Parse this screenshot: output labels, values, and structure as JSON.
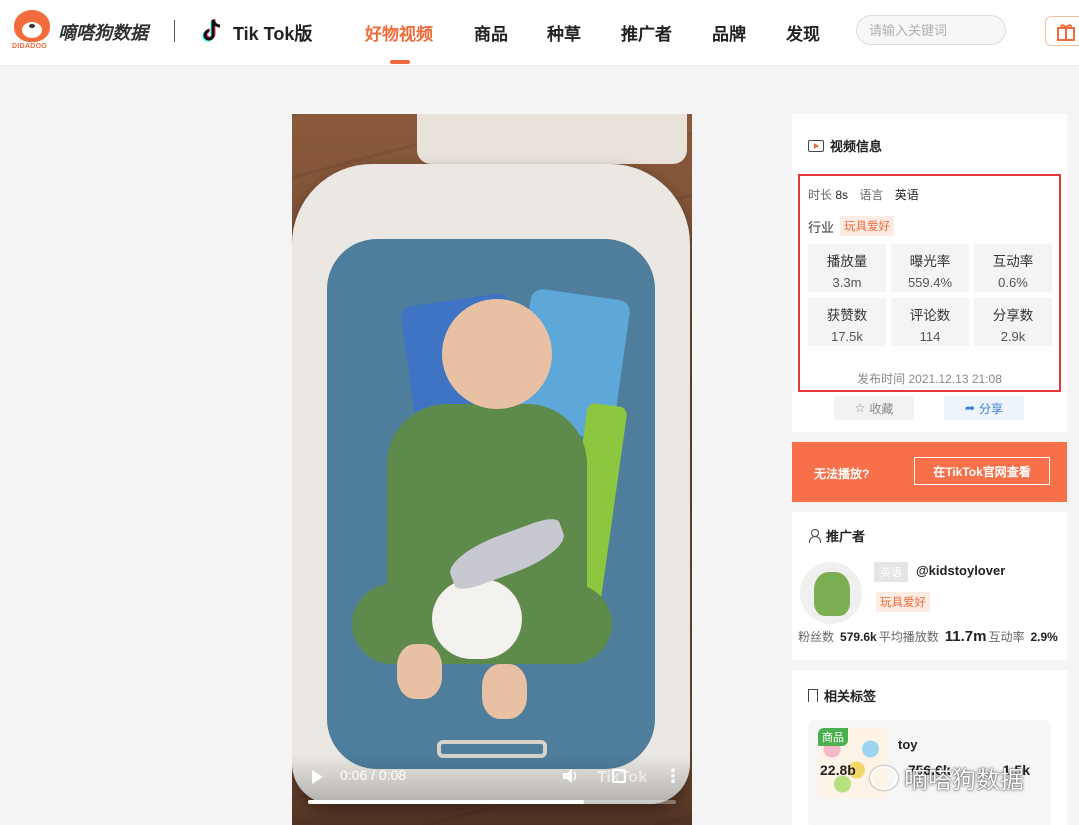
{
  "header": {
    "brand_name": "嘀嗒狗数据",
    "logo_sub": "DIDADOG",
    "platform": "Tik Tok版",
    "nav": [
      "好物视频",
      "商品",
      "种草",
      "推广者",
      "品牌",
      "发现"
    ],
    "active_nav": "好物视频",
    "search_placeholder": "请输入关键词",
    "accent_color": "#f26b3a"
  },
  "video": {
    "current_time": "0:06 / 0:08",
    "progress": 0.75,
    "watermark": "TikTok"
  },
  "video_info": {
    "title": "视频信息",
    "duration_label": "时长",
    "duration": "8s",
    "language_label": "语言",
    "language": "英语",
    "industry_label": "行业",
    "industry": "玩具爱好",
    "stats": [
      {
        "label": "播放量",
        "value": "3.3m"
      },
      {
        "label": "曝光率",
        "value": "559.4%"
      },
      {
        "label": "互动率",
        "value": "0.6%"
      },
      {
        "label": "获赞数",
        "value": "17.5k"
      },
      {
        "label": "评论数",
        "value": "114"
      },
      {
        "label": "分享数",
        "value": "2.9k"
      }
    ],
    "publish_time": "发布时间 2021.12.13 21:08",
    "favorite": "收藏",
    "share": "分享"
  },
  "banner": {
    "text": "无法播放?",
    "button": "在TikTok官网查看"
  },
  "promoter": {
    "title": "推广者",
    "lang": "英语",
    "handle": "@kidstoylover",
    "tag": "玩具爱好",
    "fans_label": "粉丝数",
    "fans": "579.6k",
    "avg_play_label": "平均播放数",
    "avg_play": "11.7m",
    "engagement_label": "互动率",
    "engagement": "2.9%"
  },
  "related_tags": {
    "title": "相关标签",
    "item": {
      "badge": "商品",
      "name": "toy",
      "stats": [
        "22.8b",
        "756.6k",
        "1.5k"
      ]
    }
  },
  "watermark_text": "嘀嗒狗数据"
}
